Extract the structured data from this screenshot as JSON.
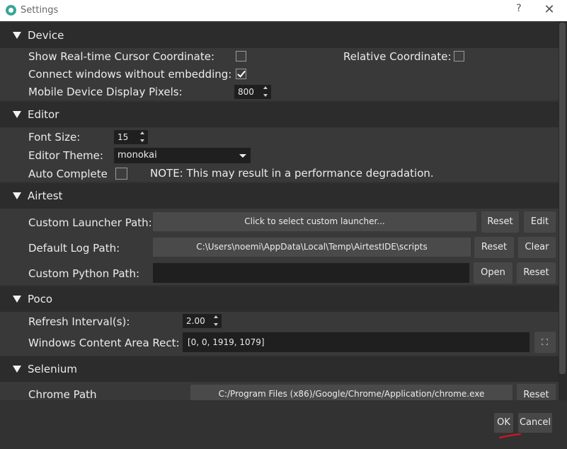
{
  "window": {
    "title": "Settings",
    "help_glyph": "?",
    "close_glyph": "✕",
    "icon": "gear-icon"
  },
  "device": {
    "title": "Device",
    "show_cursor_label": "Show Real-time Cursor Coordinate:",
    "show_cursor_checked": false,
    "relative_label": "Relative Coordinate:",
    "relative_checked": false,
    "connect_label": "Connect windows without embedding:",
    "connect_checked": true,
    "pixels_label": "Mobile Device Display Pixels:",
    "pixels_value": "800"
  },
  "editor": {
    "title": "Editor",
    "font_size_label": "Font Size:",
    "font_size_value": "15",
    "theme_label": "Editor Theme:",
    "theme_value": "monokai",
    "autocomplete_label": "Auto Complete",
    "autocomplete_checked": false,
    "note": "NOTE: This may result in a performance degradation."
  },
  "airtest": {
    "title": "Airtest",
    "launcher_label": "Custom Launcher Path:",
    "launcher_value": "Click to select custom launcher...",
    "launcher_reset": "Reset",
    "launcher_edit": "Edit",
    "log_label": "Default Log Path:",
    "log_value": "C:\\Users\\noemi\\AppData\\Local\\Temp\\AirtestIDE\\scripts",
    "log_reset": "Reset",
    "log_clear": "Clear",
    "python_label": "Custom Python Path:",
    "python_value": "",
    "python_open": "Open",
    "python_reset": "Reset"
  },
  "poco": {
    "title": "Poco",
    "refresh_label": "Refresh Interval(s):",
    "refresh_value": "2.00",
    "rect_label": "Windows Content Area Rect:",
    "rect_value": "[0, 0, 1919, 1079]",
    "rect_icon": "expand-icon"
  },
  "selenium": {
    "title": "Selenium",
    "chrome_label": "Chrome Path",
    "chrome_value": "C:/Program Files (x86)/Google/Chrome/Application/chrome.exe",
    "chrome_reset": "Reset"
  },
  "footer": {
    "ok_label": "OK",
    "cancel_label": "Cancel"
  },
  "colors": {
    "background": "#323232",
    "section_header": "#2c2c2c",
    "section_body": "#393939",
    "button": "#474747",
    "input": "#1f1f1f",
    "annotation_red": "#e0141e",
    "app_icon": "#38a596"
  }
}
